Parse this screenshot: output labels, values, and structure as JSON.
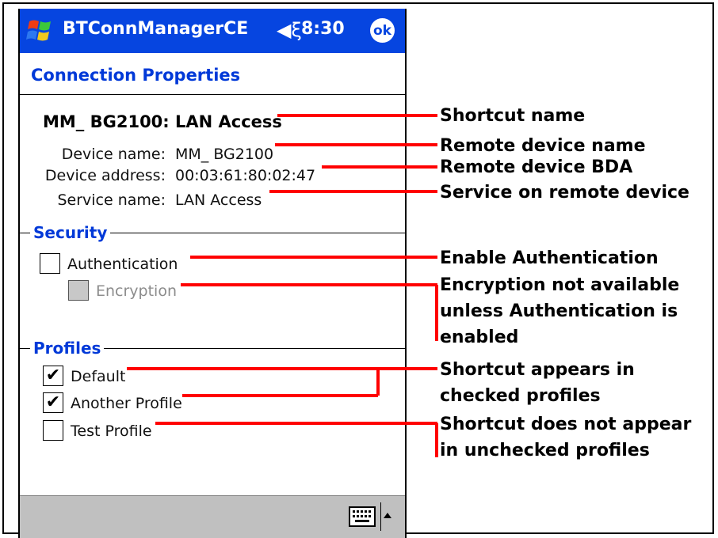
{
  "titlebar": {
    "app_title": "BTConnManagerCE",
    "time": "8:30",
    "ok_label": "ok",
    "speaker_glyph": "◀ξ"
  },
  "page": {
    "title": "Connection Properties"
  },
  "shortcut": {
    "name": "MM_ BG2100: LAN Access"
  },
  "properties": [
    {
      "label": "Device name:",
      "value": "MM_ BG2100"
    },
    {
      "label": "Device address:",
      "value": "00:03:61:80:02:47"
    },
    {
      "label": "Service name:",
      "value": "LAN Access"
    }
  ],
  "security": {
    "heading": "Security",
    "authentication": {
      "label": "Authentication",
      "checked": false
    },
    "encryption": {
      "label": "Encryption",
      "checked": false,
      "enabled": false
    }
  },
  "profiles": {
    "heading": "Profiles",
    "items": [
      {
        "label": "Default",
        "checked": true
      },
      {
        "label": "Another Profile",
        "checked": true
      },
      {
        "label": "Test Profile",
        "checked": false
      }
    ]
  },
  "annotations": {
    "shortcut_name": [
      "Shortcut name"
    ],
    "remote_device_name": [
      "Remote device name"
    ],
    "remote_device_bda": [
      "Remote device BDA"
    ],
    "service": [
      "Service on remote device"
    ],
    "enable_auth": [
      "Enable Authentication"
    ],
    "encryption": [
      "Encryption not available",
      "unless Authentication is",
      "enabled"
    ],
    "checked_profiles": [
      "Shortcut appears in",
      "checked profiles"
    ],
    "unchecked_profiles": [
      "Shortcut does not appear",
      "in unchecked profiles"
    ]
  },
  "colors": {
    "titlebar": "#0645e0",
    "heading": "#0039d8",
    "callout_line": "#ff0000",
    "bottom_bar": "#c0c0c0"
  },
  "icons": {
    "start": "windows-flag-icon",
    "speaker": "speaker-icon",
    "keyboard": "keyboard-icon",
    "sip_arrow": "up-arrow-icon",
    "check": "checkmark-icon"
  }
}
